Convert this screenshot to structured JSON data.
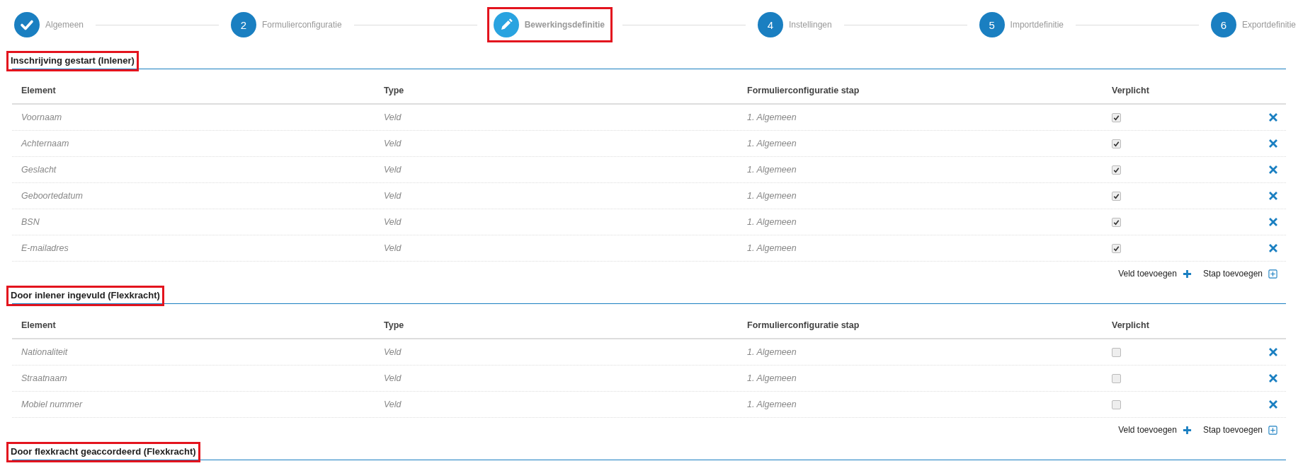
{
  "steps": [
    {
      "kind": "done",
      "label": "Algemeen",
      "selected": false,
      "highlighted": false
    },
    {
      "kind": "number",
      "number": "2",
      "label": "Formulierconfiguratie",
      "selected": false,
      "highlighted": false
    },
    {
      "kind": "current",
      "label": "Bewerkingsdefinitie",
      "selected": true,
      "highlighted": true
    },
    {
      "kind": "number",
      "number": "4",
      "label": "Instellingen",
      "selected": false,
      "highlighted": false
    },
    {
      "kind": "number",
      "number": "5",
      "label": "Importdefinitie",
      "selected": false,
      "highlighted": false
    },
    {
      "kind": "number",
      "number": "6",
      "label": "Exportdefinitie",
      "selected": false,
      "highlighted": false
    }
  ],
  "sections": [
    {
      "title": "Inschrijving gestart (Inlener)",
      "highlighted": true,
      "columns": [
        "Element",
        "Type",
        "Formulierconfiguratie stap",
        "Verplicht"
      ],
      "rows": [
        {
          "element": "Voornaam",
          "type": "Veld",
          "step": "1. Algemeen",
          "checked": true
        },
        {
          "element": "Achternaam",
          "type": "Veld",
          "step": "1. Algemeen",
          "checked": true
        },
        {
          "element": "Geslacht",
          "type": "Veld",
          "step": "1. Algemeen",
          "checked": true
        },
        {
          "element": "Geboortedatum",
          "type": "Veld",
          "step": "1. Algemeen",
          "checked": true
        },
        {
          "element": "BSN",
          "type": "Veld",
          "step": "1. Algemeen",
          "checked": true
        },
        {
          "element": "E-mailadres",
          "type": "Veld",
          "step": "1. Algemeen",
          "checked": true
        }
      ],
      "actions": [
        "Veld toevoegen",
        "Stap toevoegen"
      ]
    },
    {
      "title": "Door inlener ingevuld (Flexkracht)",
      "highlighted": true,
      "columns": [
        "Element",
        "Type",
        "Formulierconfiguratie stap",
        "Verplicht"
      ],
      "rows": [
        {
          "element": "Nationaliteit",
          "type": "Veld",
          "step": "1. Algemeen",
          "checked": false
        },
        {
          "element": "Straatnaam",
          "type": "Veld",
          "step": "1. Algemeen",
          "checked": false
        },
        {
          "element": "Mobiel nummer",
          "type": "Veld",
          "step": "1. Algemeen",
          "checked": false
        }
      ],
      "actions": [
        "Veld toevoegen",
        "Stap toevoegen"
      ]
    },
    {
      "title": "Door flexkracht geaccordeerd (Flexkracht)",
      "highlighted": true
    }
  ]
}
